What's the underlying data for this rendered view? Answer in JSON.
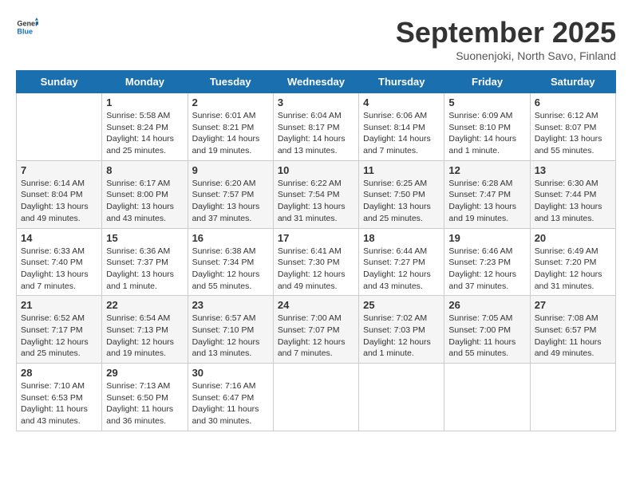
{
  "header": {
    "logo_general": "General",
    "logo_blue": "Blue",
    "month_title": "September 2025",
    "location": "Suonenjoki, North Savo, Finland"
  },
  "weekdays": [
    "Sunday",
    "Monday",
    "Tuesday",
    "Wednesday",
    "Thursday",
    "Friday",
    "Saturday"
  ],
  "weeks": [
    [
      {
        "day": "",
        "info": ""
      },
      {
        "day": "1",
        "info": "Sunrise: 5:58 AM\nSunset: 8:24 PM\nDaylight: 14 hours\nand 25 minutes."
      },
      {
        "day": "2",
        "info": "Sunrise: 6:01 AM\nSunset: 8:21 PM\nDaylight: 14 hours\nand 19 minutes."
      },
      {
        "day": "3",
        "info": "Sunrise: 6:04 AM\nSunset: 8:17 PM\nDaylight: 14 hours\nand 13 minutes."
      },
      {
        "day": "4",
        "info": "Sunrise: 6:06 AM\nSunset: 8:14 PM\nDaylight: 14 hours\nand 7 minutes."
      },
      {
        "day": "5",
        "info": "Sunrise: 6:09 AM\nSunset: 8:10 PM\nDaylight: 14 hours\nand 1 minute."
      },
      {
        "day": "6",
        "info": "Sunrise: 6:12 AM\nSunset: 8:07 PM\nDaylight: 13 hours\nand 55 minutes."
      }
    ],
    [
      {
        "day": "7",
        "info": "Sunrise: 6:14 AM\nSunset: 8:04 PM\nDaylight: 13 hours\nand 49 minutes."
      },
      {
        "day": "8",
        "info": "Sunrise: 6:17 AM\nSunset: 8:00 PM\nDaylight: 13 hours\nand 43 minutes."
      },
      {
        "day": "9",
        "info": "Sunrise: 6:20 AM\nSunset: 7:57 PM\nDaylight: 13 hours\nand 37 minutes."
      },
      {
        "day": "10",
        "info": "Sunrise: 6:22 AM\nSunset: 7:54 PM\nDaylight: 13 hours\nand 31 minutes."
      },
      {
        "day": "11",
        "info": "Sunrise: 6:25 AM\nSunset: 7:50 PM\nDaylight: 13 hours\nand 25 minutes."
      },
      {
        "day": "12",
        "info": "Sunrise: 6:28 AM\nSunset: 7:47 PM\nDaylight: 13 hours\nand 19 minutes."
      },
      {
        "day": "13",
        "info": "Sunrise: 6:30 AM\nSunset: 7:44 PM\nDaylight: 13 hours\nand 13 minutes."
      }
    ],
    [
      {
        "day": "14",
        "info": "Sunrise: 6:33 AM\nSunset: 7:40 PM\nDaylight: 13 hours\nand 7 minutes."
      },
      {
        "day": "15",
        "info": "Sunrise: 6:36 AM\nSunset: 7:37 PM\nDaylight: 13 hours\nand 1 minute."
      },
      {
        "day": "16",
        "info": "Sunrise: 6:38 AM\nSunset: 7:34 PM\nDaylight: 12 hours\nand 55 minutes."
      },
      {
        "day": "17",
        "info": "Sunrise: 6:41 AM\nSunset: 7:30 PM\nDaylight: 12 hours\nand 49 minutes."
      },
      {
        "day": "18",
        "info": "Sunrise: 6:44 AM\nSunset: 7:27 PM\nDaylight: 12 hours\nand 43 minutes."
      },
      {
        "day": "19",
        "info": "Sunrise: 6:46 AM\nSunset: 7:23 PM\nDaylight: 12 hours\nand 37 minutes."
      },
      {
        "day": "20",
        "info": "Sunrise: 6:49 AM\nSunset: 7:20 PM\nDaylight: 12 hours\nand 31 minutes."
      }
    ],
    [
      {
        "day": "21",
        "info": "Sunrise: 6:52 AM\nSunset: 7:17 PM\nDaylight: 12 hours\nand 25 minutes."
      },
      {
        "day": "22",
        "info": "Sunrise: 6:54 AM\nSunset: 7:13 PM\nDaylight: 12 hours\nand 19 minutes."
      },
      {
        "day": "23",
        "info": "Sunrise: 6:57 AM\nSunset: 7:10 PM\nDaylight: 12 hours\nand 13 minutes."
      },
      {
        "day": "24",
        "info": "Sunrise: 7:00 AM\nSunset: 7:07 PM\nDaylight: 12 hours\nand 7 minutes."
      },
      {
        "day": "25",
        "info": "Sunrise: 7:02 AM\nSunset: 7:03 PM\nDaylight: 12 hours\nand 1 minute."
      },
      {
        "day": "26",
        "info": "Sunrise: 7:05 AM\nSunset: 7:00 PM\nDaylight: 11 hours\nand 55 minutes."
      },
      {
        "day": "27",
        "info": "Sunrise: 7:08 AM\nSunset: 6:57 PM\nDaylight: 11 hours\nand 49 minutes."
      }
    ],
    [
      {
        "day": "28",
        "info": "Sunrise: 7:10 AM\nSunset: 6:53 PM\nDaylight: 11 hours\nand 43 minutes."
      },
      {
        "day": "29",
        "info": "Sunrise: 7:13 AM\nSunset: 6:50 PM\nDaylight: 11 hours\nand 36 minutes."
      },
      {
        "day": "30",
        "info": "Sunrise: 7:16 AM\nSunset: 6:47 PM\nDaylight: 11 hours\nand 30 minutes."
      },
      {
        "day": "",
        "info": ""
      },
      {
        "day": "",
        "info": ""
      },
      {
        "day": "",
        "info": ""
      },
      {
        "day": "",
        "info": ""
      }
    ]
  ]
}
